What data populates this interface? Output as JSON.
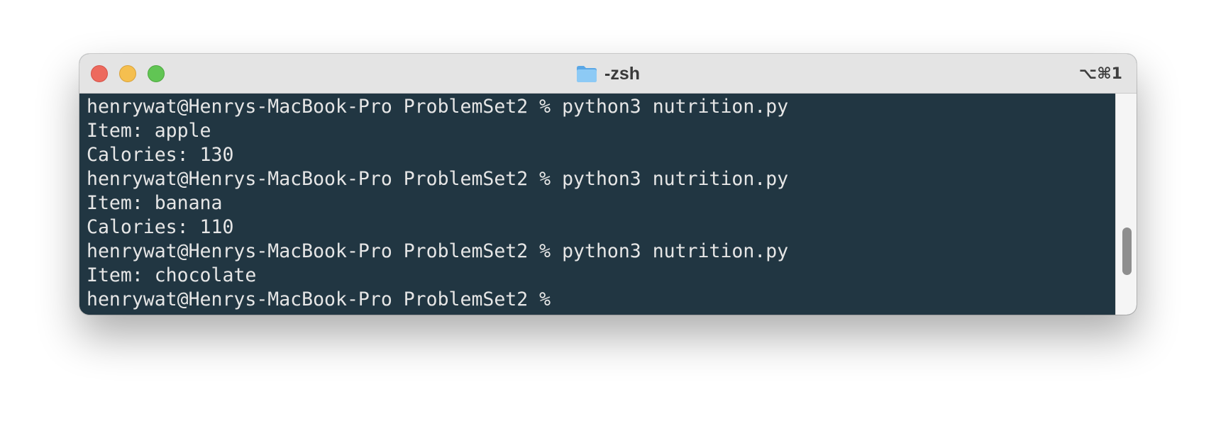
{
  "window": {
    "title": "-zsh",
    "shortcut": "⌥⌘1"
  },
  "terminal": {
    "lines": [
      "henrywat@Henrys-MacBook-Pro ProblemSet2 % python3 nutrition.py",
      "Item: apple",
      "Calories: 130",
      "henrywat@Henrys-MacBook-Pro ProblemSet2 % python3 nutrition.py",
      "Item: banana",
      "Calories: 110",
      "henrywat@Henrys-MacBook-Pro ProblemSet2 % python3 nutrition.py",
      "Item: chocolate",
      "henrywat@Henrys-MacBook-Pro ProblemSet2 % "
    ]
  },
  "scrollbar": {
    "position": 0.78,
    "visible_fraction": 0.22
  },
  "colors": {
    "terminal_background": "#213642",
    "terminal_text": "#e6e6e6",
    "titlebar": "#e4e4e4",
    "close": "#ed6a5e",
    "minimize": "#f5bf4f",
    "zoom": "#61c554",
    "folder": "#6cb4ee"
  },
  "icons": {
    "title_icon": "folder-icon"
  }
}
